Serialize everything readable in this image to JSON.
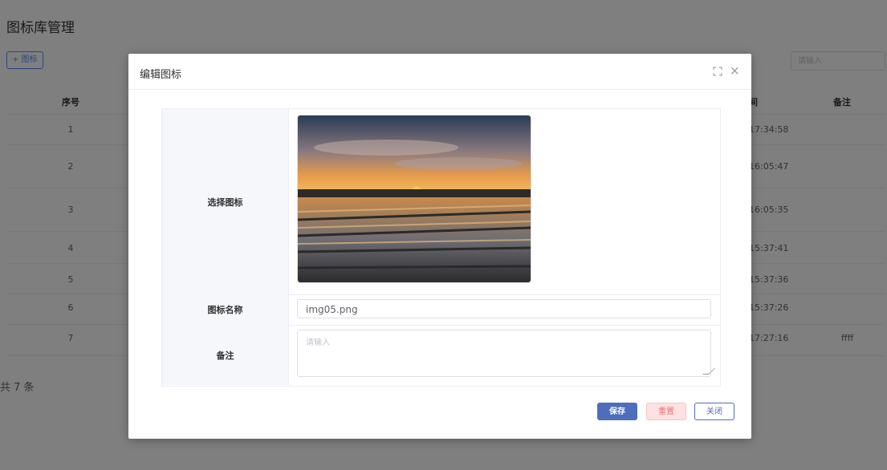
{
  "page": {
    "title": "图标库管理",
    "add_button": "+ 图标",
    "search_placeholder": "请输入",
    "total_text": "共 7 条"
  },
  "table": {
    "headers": {
      "index": "序号",
      "time": "间",
      "remark": "备注"
    },
    "rows": [
      {
        "index": "1",
        "time": "17:34:58",
        "remark": ""
      },
      {
        "index": "2",
        "time": "16:05:47",
        "remark": ""
      },
      {
        "index": "3",
        "time": "16:05:35",
        "remark": ""
      },
      {
        "index": "4",
        "time": "15:37:41",
        "remark": ""
      },
      {
        "index": "5",
        "time": "15:37:36",
        "remark": ""
      },
      {
        "index": "6",
        "time": "15:37:26",
        "remark": ""
      },
      {
        "index": "7",
        "time": "17:27:16",
        "remark": "ffff"
      }
    ]
  },
  "dialog": {
    "title": "编辑图标",
    "fields": {
      "icon_label": "选择图标",
      "name_label": "图标名称",
      "name_value": "img05.png",
      "remark_label": "备注",
      "remark_placeholder": "请输入"
    },
    "buttons": {
      "save": "保存",
      "reset": "重置",
      "close": "关闭"
    }
  },
  "colors": {
    "primary": "#4e6ebc",
    "danger": "#f56c6c",
    "overlay": "rgba(0,0,0,0.5)"
  },
  "icons": {
    "fullscreen": "fullscreen-icon",
    "close": "close-icon"
  }
}
